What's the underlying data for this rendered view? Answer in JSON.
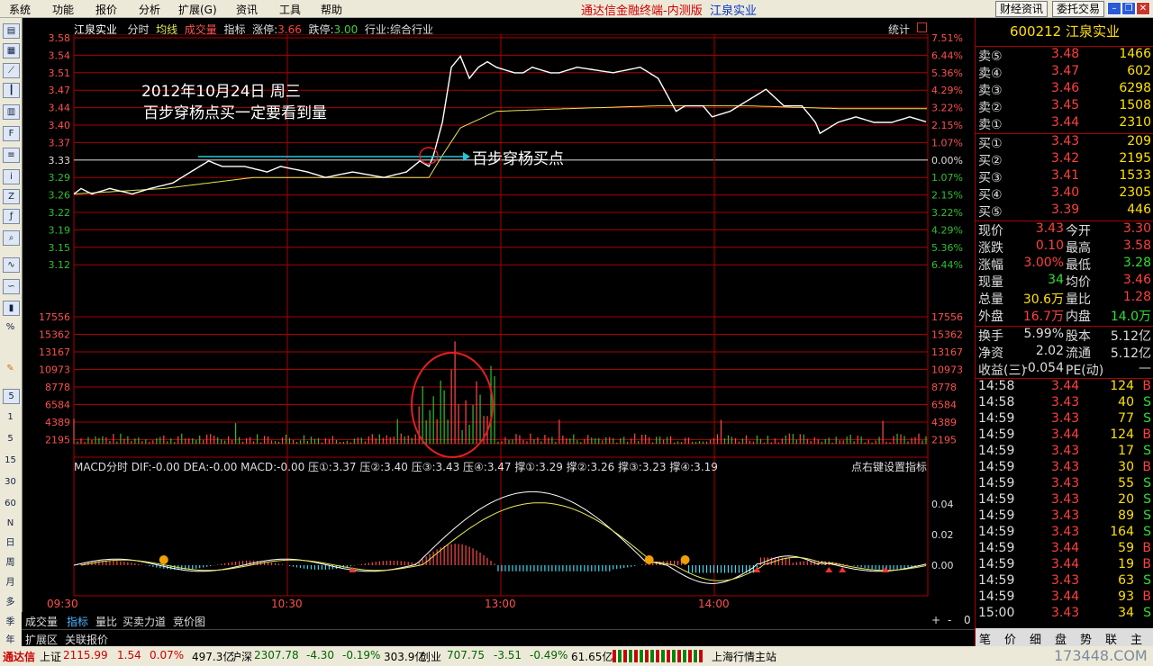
{
  "menu": {
    "items": [
      "系统",
      "功能",
      "报价",
      "分析",
      "扩展(G)",
      "资讯",
      "工具",
      "帮助"
    ],
    "title": "通达信金融终端-内测版",
    "stock": "江泉实业",
    "btn1": "财经资讯",
    "btn2": "委托交易"
  },
  "header": {
    "name": "江泉实业",
    "p1": "分时",
    "p2": "均线",
    "p3": "成交量",
    "p4": "指标",
    "limit_up_lbl": "涨停:",
    "limit_up": "3.66",
    "limit_dn_lbl": "跌停:",
    "limit_dn": "3.00",
    "industry": "行业:综合行业",
    "stat": "统计"
  },
  "left_price_ticks": [
    "3.58",
    "3.54",
    "3.51",
    "3.47",
    "3.44",
    "3.40",
    "3.37",
    "3.33",
    "3.29",
    "3.26",
    "3.22",
    "3.19",
    "3.15",
    "3.12"
  ],
  "right_pct_ticks": [
    "7.51%",
    "6.44%",
    "5.36%",
    "4.29%",
    "3.22%",
    "2.15%",
    "1.07%",
    "0.00%",
    "1.07%",
    "2.15%",
    "3.22%",
    "4.29%",
    "5.36%",
    "6.44%"
  ],
  "vol_ticks": [
    "17556",
    "15362",
    "13167",
    "10973",
    "8778",
    "6584",
    "4389",
    "2195"
  ],
  "macd_ticks": [
    "0.04",
    "0.02",
    "0.00"
  ],
  "macd_header": "MACD分时  DIF:-0.00  DEA:-0.00  MACD:-0.00  压①:3.37  压②:3.40  压③:3.43  压④:3.47  撑①:3.29  撑②:3.26  撑③:3.23  撑④:3.19",
  "macd_right": "点右键设置指标",
  "time_ticks": [
    "09:30",
    "10:30",
    "13:00",
    "14:00"
  ],
  "annotation": {
    "line1": "2012年10月24日  周三",
    "line2": "百步穿杨点买一定要看到量",
    "arrow_text": "百步穿杨买点"
  },
  "chart_data": {
    "type": "line",
    "title": "江泉实业",
    "prev_close": 3.33,
    "ylim": [
      3.1,
      3.59
    ],
    "series": [
      {
        "name": "分时",
        "color": "#ffffff",
        "points": [
          [
            0,
            3.3
          ],
          [
            8,
            3.31
          ],
          [
            20,
            3.3
          ],
          [
            40,
            3.31
          ],
          [
            65,
            3.3
          ],
          [
            85,
            3.31
          ],
          [
            110,
            3.32
          ],
          [
            140,
            3.35
          ],
          [
            150,
            3.36
          ],
          [
            165,
            3.35
          ],
          [
            190,
            3.35
          ],
          [
            215,
            3.34
          ],
          [
            230,
            3.35
          ],
          [
            260,
            3.34
          ],
          [
            280,
            3.33
          ],
          [
            310,
            3.34
          ],
          [
            345,
            3.33
          ],
          [
            370,
            3.34
          ],
          [
            385,
            3.36
          ],
          [
            395,
            3.35
          ],
          [
            400,
            3.37
          ],
          [
            410,
            3.43
          ],
          [
            420,
            3.53
          ],
          [
            430,
            3.55
          ],
          [
            440,
            3.51
          ],
          [
            450,
            3.53
          ],
          [
            460,
            3.54
          ],
          [
            470,
            3.53
          ],
          [
            490,
            3.52
          ],
          [
            500,
            3.52
          ],
          [
            510,
            3.53
          ],
          [
            530,
            3.52
          ],
          [
            540,
            3.52
          ],
          [
            560,
            3.53
          ],
          [
            600,
            3.52
          ],
          [
            630,
            3.53
          ],
          [
            650,
            3.51
          ],
          [
            660,
            3.48
          ],
          [
            670,
            3.45
          ],
          [
            680,
            3.46
          ],
          [
            700,
            3.46
          ],
          [
            710,
            3.44
          ],
          [
            730,
            3.45
          ],
          [
            750,
            3.47
          ],
          [
            770,
            3.49
          ],
          [
            790,
            3.46
          ],
          [
            810,
            3.46
          ],
          [
            825,
            3.43
          ],
          [
            830,
            3.41
          ],
          [
            850,
            3.43
          ],
          [
            870,
            3.44
          ],
          [
            890,
            3.43
          ],
          [
            910,
            3.43
          ],
          [
            930,
            3.44
          ],
          [
            950,
            3.43
          ]
        ]
      },
      {
        "name": "均线",
        "color": "#e8e85a",
        "points": [
          [
            0,
            3.3
          ],
          [
            100,
            3.31
          ],
          [
            200,
            3.33
          ],
          [
            300,
            3.33
          ],
          [
            395,
            3.33
          ],
          [
            410,
            3.37
          ],
          [
            430,
            3.42
          ],
          [
            470,
            3.45
          ],
          [
            550,
            3.455
          ],
          [
            650,
            3.46
          ],
          [
            750,
            3.46
          ],
          [
            850,
            3.455
          ],
          [
            950,
            3.455
          ]
        ]
      }
    ],
    "volume_ylim": [
      0,
      19750
    ],
    "volume_peak": {
      "index": 426,
      "value": 15800
    },
    "macd_ylim": [
      -0.02,
      0.06
    ]
  },
  "quote": {
    "code": "600212",
    "name": "江泉实业",
    "sell": [
      {
        "l": "卖⑤",
        "p": "3.48",
        "v": "1466"
      },
      {
        "l": "卖④",
        "p": "3.47",
        "v": "602"
      },
      {
        "l": "卖③",
        "p": "3.46",
        "v": "6298"
      },
      {
        "l": "卖②",
        "p": "3.45",
        "v": "1508"
      },
      {
        "l": "卖①",
        "p": "3.44",
        "v": "2310"
      }
    ],
    "buy": [
      {
        "l": "买①",
        "p": "3.43",
        "v": "209"
      },
      {
        "l": "买②",
        "p": "3.42",
        "v": "2195"
      },
      {
        "l": "买③",
        "p": "3.41",
        "v": "1533"
      },
      {
        "l": "买④",
        "p": "3.40",
        "v": "2305"
      },
      {
        "l": "买⑤",
        "p": "3.39",
        "v": "446"
      }
    ],
    "stats": [
      {
        "a": "现价",
        "b": "3.43",
        "c": "今开",
        "d": "3.30"
      },
      {
        "a": "涨跌",
        "b": "0.10",
        "c": "最高",
        "d": "3.58"
      },
      {
        "a": "涨幅",
        "b": "3.00%",
        "c": "最低",
        "d": "3.28"
      },
      {
        "a": "现量",
        "b": "34",
        "c": "均价",
        "d": "3.46"
      },
      {
        "a": "总量",
        "b": "30.6万",
        "c": "量比",
        "d": "1.28"
      },
      {
        "a": "外盘",
        "b": "16.7万",
        "c": "内盘",
        "d": "14.0万"
      }
    ],
    "stats2": [
      {
        "a": "换手",
        "b": "5.99%",
        "c": "股本",
        "d": "5.12亿"
      },
      {
        "a": "净资",
        "b": "2.02",
        "c": "流通",
        "d": "5.12亿"
      },
      {
        "a": "收益(三)",
        "b": "-0.054",
        "c": "PE(动)",
        "d": "—"
      }
    ],
    "ticks": [
      {
        "t": "14:58",
        "p": "3.44",
        "v": "124",
        "s": "B"
      },
      {
        "t": "14:58",
        "p": "3.43",
        "v": "40",
        "s": "S"
      },
      {
        "t": "14:59",
        "p": "3.43",
        "v": "77",
        "s": "S"
      },
      {
        "t": "14:59",
        "p": "3.44",
        "v": "124",
        "s": "B"
      },
      {
        "t": "14:59",
        "p": "3.43",
        "v": "17",
        "s": "S"
      },
      {
        "t": "14:59",
        "p": "3.43",
        "v": "30",
        "s": "B"
      },
      {
        "t": "14:59",
        "p": "3.43",
        "v": "55",
        "s": "S"
      },
      {
        "t": "14:59",
        "p": "3.43",
        "v": "20",
        "s": "S"
      },
      {
        "t": "14:59",
        "p": "3.43",
        "v": "89",
        "s": "S"
      },
      {
        "t": "14:59",
        "p": "3.43",
        "v": "164",
        "s": "S"
      },
      {
        "t": "14:59",
        "p": "3.44",
        "v": "59",
        "s": "B"
      },
      {
        "t": "14:59",
        "p": "3.44",
        "v": "19",
        "s": "B"
      },
      {
        "t": "14:59",
        "p": "3.43",
        "v": "63",
        "s": "S"
      },
      {
        "t": "14:59",
        "p": "3.44",
        "v": "93",
        "s": "B"
      },
      {
        "t": "15:00",
        "p": "3.43",
        "v": "34",
        "s": "S"
      }
    ],
    "side_tabs": [
      "笔",
      "价",
      "细",
      "盘",
      "势",
      "联",
      "主"
    ]
  },
  "tabs": [
    "成交量",
    "指标",
    "量比",
    "买卖力道",
    "竞价图"
  ],
  "tabs2": [
    "扩展区",
    "关联报价"
  ],
  "status": {
    "brand": "通达信",
    "sh_lbl": "上证",
    "sh": "2115.99",
    "sh_chg": "1.54",
    "sh_pct": "0.07%",
    "sh_amt": "497.3亿",
    "hs_lbl": "沪深",
    "hs": "2307.78",
    "hs_chg": "-4.30",
    "hs_pct": "-0.19%",
    "hs_amt": "303.9亿",
    "cy_lbl": "创业",
    "cy": "707.75",
    "cy_chg": "-3.51",
    "cy_pct": "-0.49%",
    "cy_amt": "61.65亿",
    "station": "上海行情主站",
    "watermark": "173448.COM"
  },
  "toolbar_labels": [
    "1",
    "5",
    "15",
    "30",
    "60",
    "N",
    "日",
    "周",
    "月",
    "多",
    "季",
    "年"
  ]
}
